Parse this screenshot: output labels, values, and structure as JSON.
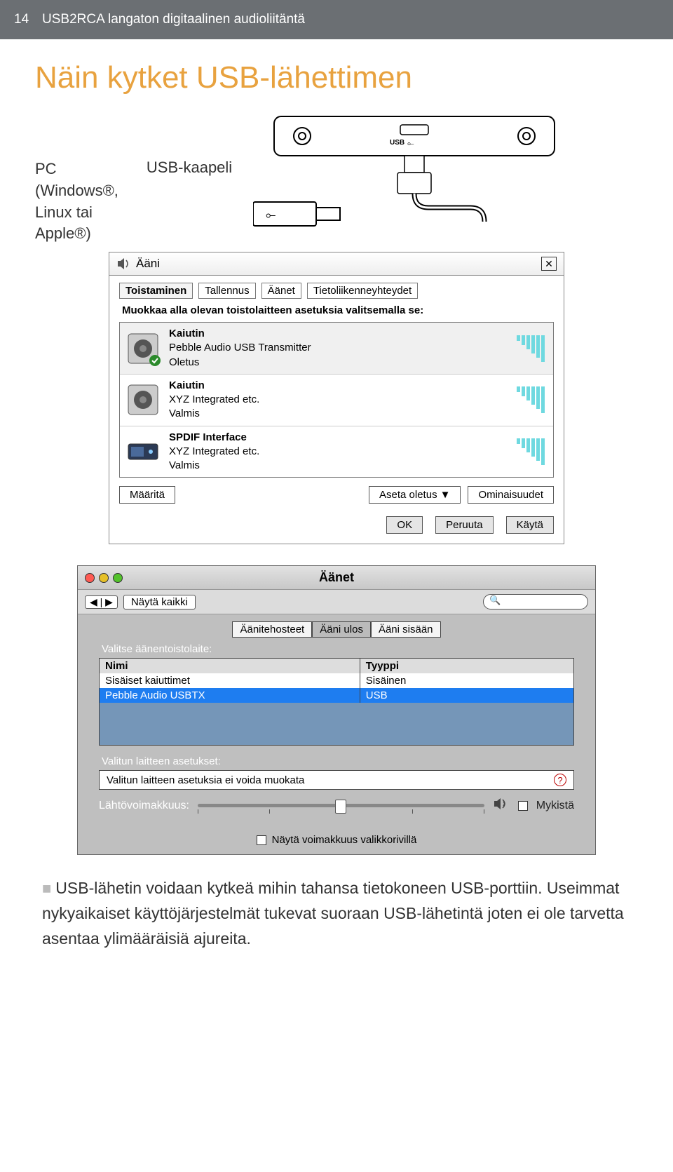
{
  "header": {
    "page_number": "14",
    "title": "USB2RCA langaton digitaalinen audioliitäntä"
  },
  "heading": "Näin kytket USB-lähettimen",
  "labels": {
    "pc_line1": "PC",
    "pc_line2": "(Windows®,",
    "pc_line3": "Linux tai",
    "pc_line4": "Apple®)",
    "cable": "USB-kaapeli",
    "usb_port": "USB"
  },
  "win": {
    "title": "Ääni",
    "tabs": [
      "Toistaminen",
      "Tallennus",
      "Äänet",
      "Tietoliikenneyhteydet"
    ],
    "instruction": "Muokkaa alla olevan toistolaitteen asetuksia valitsemalla se:",
    "devices": [
      {
        "name": "Kaiutin",
        "sub": "Pebble Audio USB Transmitter",
        "status": "Oletus",
        "selected": true,
        "kind": "speaker"
      },
      {
        "name": "Kaiutin",
        "sub": "XYZ Integrated etc.",
        "status": "Valmis",
        "selected": false,
        "kind": "speaker"
      },
      {
        "name": "SPDIF Interface",
        "sub": "XYZ Integrated etc.",
        "status": "Valmis",
        "selected": false,
        "kind": "spdif"
      }
    ],
    "btn_configure": "Määritä",
    "btn_set_default": "Aseta oletus",
    "btn_properties": "Ominaisuudet",
    "btn_ok": "OK",
    "btn_cancel": "Peruuta",
    "btn_apply": "Käytä"
  },
  "mac": {
    "title": "Äänet",
    "show_all": "Näytä kaikki",
    "tabs": [
      "Äänitehosteet",
      "Ääni ulos",
      "Ääni sisään"
    ],
    "choose_label": "Valitse äänentoistolaite:",
    "col_name": "Nimi",
    "col_type": "Tyyppi",
    "rows": [
      {
        "name": "Sisäiset kaiuttimet",
        "type": "Sisäinen",
        "selected": false
      },
      {
        "name": "Pebble Audio USBTX",
        "type": "USB",
        "selected": true
      }
    ],
    "settings_label": "Valitun laitteen asetukset:",
    "settings_text": "Valitun laitteen asetuksia ei voida muokata",
    "volume_label": "Lähtövoimakkuus:",
    "mute": "Mykistä",
    "show_menu": "Näytä voimakkuus valikkorivillä"
  },
  "body": "USB-lähetin voidaan kytkeä mihin tahansa tietokoneen USB-porttiin. Useimmat nykyaikaiset käyttöjärjestelmät tukevat suoraan USB-lähetintä joten ei ole tarvetta asentaa ylimääräisiä ajureita."
}
